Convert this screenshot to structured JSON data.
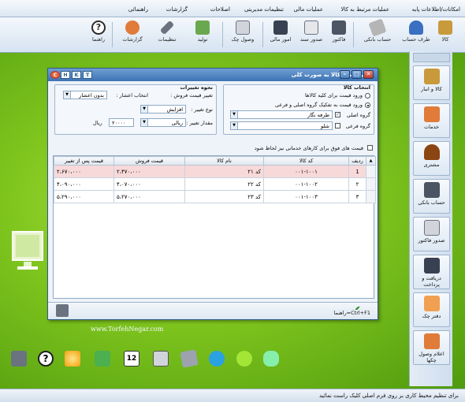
{
  "menu": [
    "امکانات/اطلاعات پایه",
    "عملیات مرتبط به کالا",
    "عملیات مالی",
    "تنظیمات مدیریتی",
    "اصلاحات",
    "گزارشات",
    "راهنمائی"
  ],
  "toolbar": {
    "items": [
      {
        "label": "کالا",
        "icon": "goods-icon",
        "color": "#c99a3b"
      },
      {
        "label": "طرف حساب",
        "icon": "person-icon",
        "color": "#3a6fc1"
      },
      {
        "label": "حساب بانکی",
        "icon": "card-icon",
        "color": "#8a8a8a"
      },
      {
        "label": "فاکتور",
        "icon": "calculator-icon",
        "color": "#4b5563"
      },
      {
        "label": "صدور سند",
        "icon": "document-icon",
        "color": "#6b7280"
      },
      {
        "label": "امور مالی",
        "icon": "finance-icon",
        "color": "#374151"
      },
      {
        "label": "وصول چک",
        "icon": "check-icon",
        "color": "#9ca3af"
      },
      {
        "label": "تولید",
        "icon": "production-icon",
        "color": "#6aa84f"
      },
      {
        "label": "تنظیمات",
        "icon": "settings-icon",
        "color": "#4b5563"
      },
      {
        "label": "گزارشات",
        "icon": "reports-icon",
        "color": "#e07b39"
      },
      {
        "label": "راهنما",
        "icon": "help-icon",
        "color": "#2b2b2b"
      }
    ]
  },
  "right_panel": {
    "items": [
      {
        "label": "کالا و انبار",
        "icon": "warehouse-icon",
        "color": "#c99a3b"
      },
      {
        "label": "خدمات",
        "icon": "services-icon",
        "color": "#e07b39"
      },
      {
        "label": "مشتری",
        "icon": "customer-icon",
        "color": "#8b4513"
      },
      {
        "label": "حساب بانکی",
        "icon": "bank-icon",
        "color": "#4b5563"
      },
      {
        "label": "صدور فاکتور",
        "icon": "invoice-icon",
        "color": "#6b7280"
      },
      {
        "label": "دریافت و پرداخت",
        "icon": "payment-icon",
        "color": "#374151"
      },
      {
        "label": "دفتر چک",
        "icon": "checkbook-icon",
        "color": "#e07b39"
      },
      {
        "label": "اعلام وصول چکها",
        "icon": "check-receipt-icon",
        "color": "#b91c1c"
      }
    ]
  },
  "dialog": {
    "title": "تغییر قیمت کالا به صورت کلی",
    "help_buttons": [
      "H",
      "K",
      "T"
    ],
    "select_group": {
      "legend": "انتخاب کالا",
      "opt_all": "ورود قیمت برای کلیه کالاها",
      "opt_by_group": "ورود قیمت به تفکیک گروه اصلی و فرعی",
      "main_group_label": "گروه اصلی",
      "main_group_value": "طرفه نگار",
      "sub_group_label": "گروه فرعی",
      "sub_group_value": "شلو"
    },
    "change_group": {
      "legend": "نحوه تغییرات",
      "price_label": "تغییر قیمت فروش :",
      "decimal_label": "انتخاب اعشار :",
      "decimal_value": "بدون اعشار",
      "type_label": "نوع تغییر :",
      "type_value": "افزایش",
      "amount_label": "مقدار تغییر :",
      "amount_type": "ریالی",
      "amount_value": "۲۰۰۰۰",
      "amount_unit": "ریال"
    },
    "services_checkbox": "قیمت های فوق برای کارهای خدماتی نیز لحاظ شود",
    "table": {
      "headers": [
        "ردیف",
        "کد کالا",
        "نام کالا",
        "قیمت فروش",
        "قیمت پس از تغییر"
      ],
      "rows": [
        {
          "row": "1",
          "code": "۰۰۱-۱۰۰۱",
          "name": "کد ۲۱",
          "price": "۲،۴۷۰،۰۰۰",
          "new_price": "۲،۶۷۰،۰۰۰"
        },
        {
          "row": "۲",
          "code": "۰۰۱-۱۰۰۲",
          "name": "کد ۲۲",
          "price": "۴،۰۷۰،۰۰۰",
          "new_price": "۴،۰۹۰،۰۰۰"
        },
        {
          "row": "۳",
          "code": "۰۰۱-۱۰۰۳",
          "name": "کد ۲۳",
          "price": "۵،۲۷۰،۰۰۰",
          "new_price": "۵،۲۹۰،۰۰۰"
        }
      ]
    },
    "help_hint": "راهنما=Ctrl+F1"
  },
  "desktop": {
    "website": "www.TorfehNegar.com"
  },
  "status_text": "برای تنظیم محیط کاری بر روی فرم اصلی کلیک راست نمائید"
}
